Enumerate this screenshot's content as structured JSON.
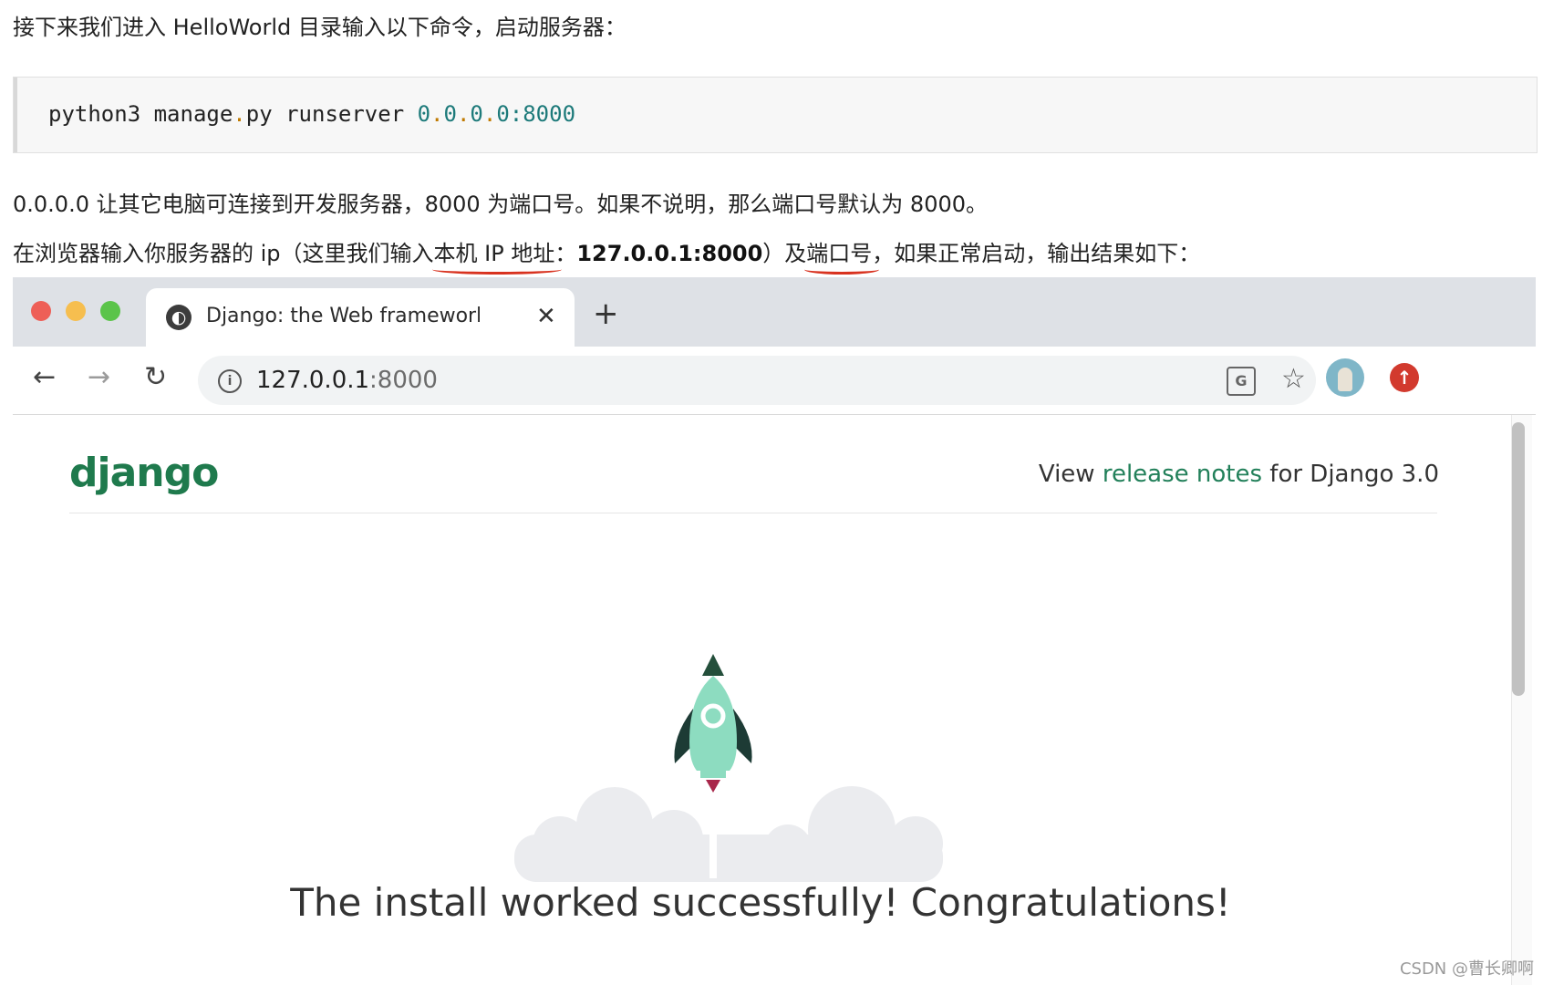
{
  "article": {
    "intro": "接下来我们进入 HelloWorld 目录输入以下命令，启动服务器：",
    "code": {
      "cmd": "python3 manage",
      "dot": ".",
      "cmd2": "py runserver ",
      "ip_a": "0",
      "ip_b": "0",
      "ip_c": "0",
      "ip_d": "0",
      "port": "8000"
    },
    "para1": "0.0.0.0 让其它电脑可连接到开发服务器，8000 为端口号。如果不说明，那么端口号默认为 8000。",
    "para2_a": "在浏览器输入你服务器的 ip（这里我们输入",
    "para2_hl1": "本机 IP 地址",
    "para2_b": "：",
    "para2_bold": "127.0.0.1:8000",
    "para2_c": "）及",
    "para2_hl2": "端口号",
    "para2_d": "，如果正常启动，输出结果如下："
  },
  "browser": {
    "tab_title": "Django: the Web framework for",
    "tab_close": "✕",
    "new_tab": "+",
    "back": "←",
    "forward": "→",
    "reload": "↻",
    "info": "i",
    "url_host": "127.0.0.1",
    "url_port": ":8000",
    "translate": "G",
    "star": "☆",
    "update": "↑",
    "globe": "◐"
  },
  "page": {
    "logo": "django",
    "release_pre": "View ",
    "release_link": "release notes",
    "release_post": " for Django 3.0",
    "headline": "The install worked successfully! Congratulations!"
  },
  "watermark": "CSDN @曹长卿啊"
}
